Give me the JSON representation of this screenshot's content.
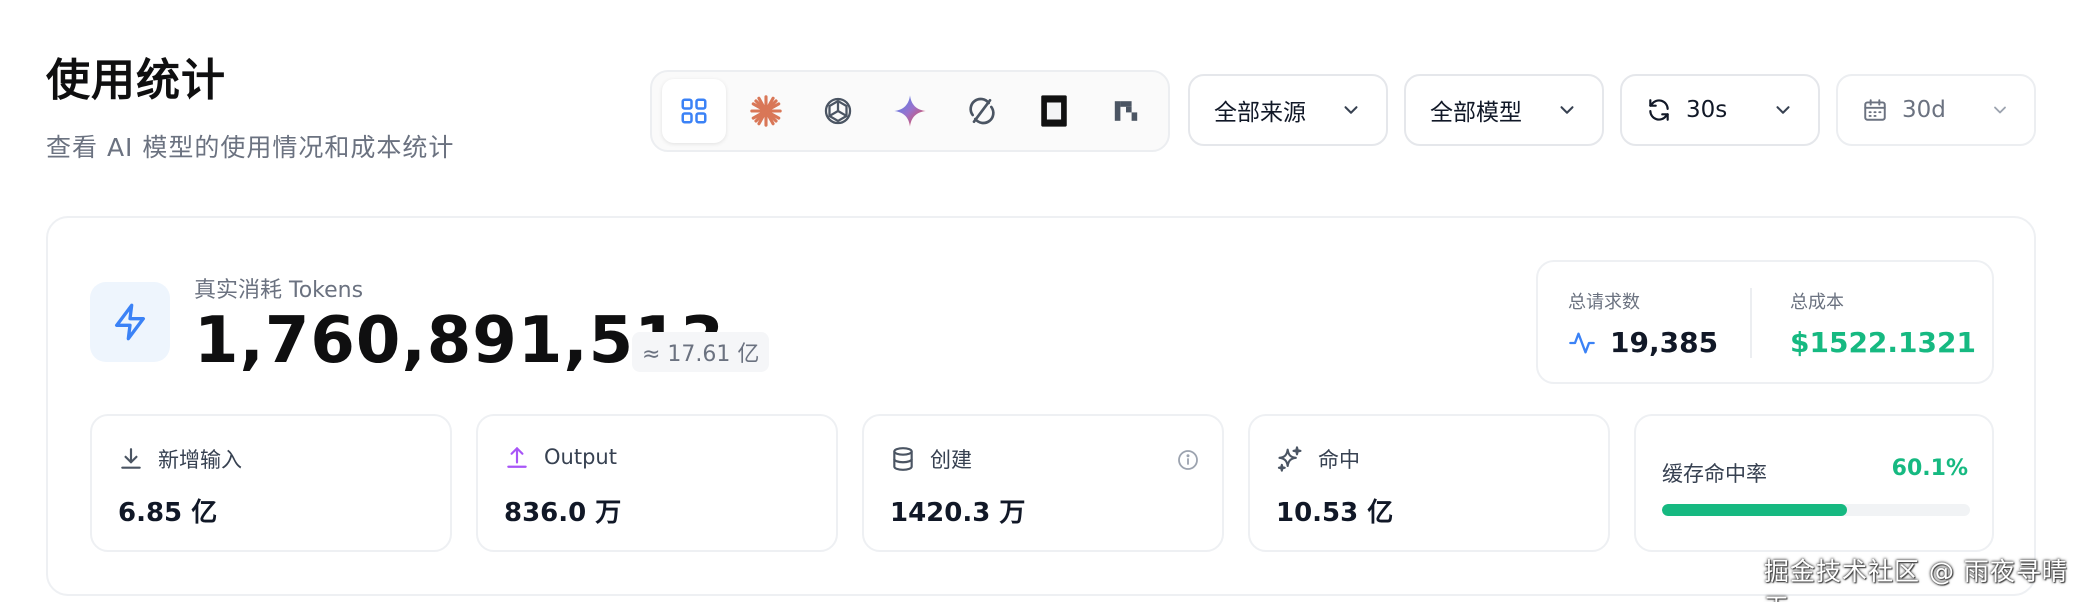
{
  "header": {
    "title": "使用统计",
    "subtitle": "查看 AI 模型的使用情况和成本统计"
  },
  "providers": [
    {
      "icon": "grid-icon",
      "active": true
    },
    {
      "icon": "claude-icon",
      "active": false
    },
    {
      "icon": "openai-icon",
      "active": false
    },
    {
      "icon": "gemini-icon",
      "active": false
    },
    {
      "icon": "cycle-logo-icon",
      "active": false
    },
    {
      "icon": "square-logo-icon",
      "active": false
    },
    {
      "icon": "pixel-logo-icon",
      "active": false
    }
  ],
  "filters": {
    "source": "全部来源",
    "model": "全部模型",
    "refresh": "30s",
    "range": "30d"
  },
  "tokens": {
    "label": "真实消耗 Tokens",
    "value": "1,760,891,513",
    "approx": "≈ 17.61 亿"
  },
  "summary": {
    "requests_label": "总请求数",
    "requests_value": "19,385",
    "cost_label": "总成本",
    "cost_value": "$1522.1321"
  },
  "metrics": [
    {
      "label": "新增输入",
      "value": "6.85 亿",
      "icon": "download-icon"
    },
    {
      "label": "Output",
      "value": "836.0 万",
      "icon": "upload-icon"
    },
    {
      "label": "创建",
      "value": "1420.3 万",
      "icon": "database-icon"
    },
    {
      "label": "命中",
      "value": "10.53 亿",
      "icon": "sparkles-icon"
    }
  ],
  "cache": {
    "label": "缓存命中率",
    "percent_text": "60.1%",
    "fraction": 0.601
  },
  "watermark": "掘金技术社区 @ 雨夜寻晴天",
  "colors": {
    "accent_blue": "#3b82f6",
    "success_green": "#16b981",
    "output_purple": "#a855f7"
  }
}
